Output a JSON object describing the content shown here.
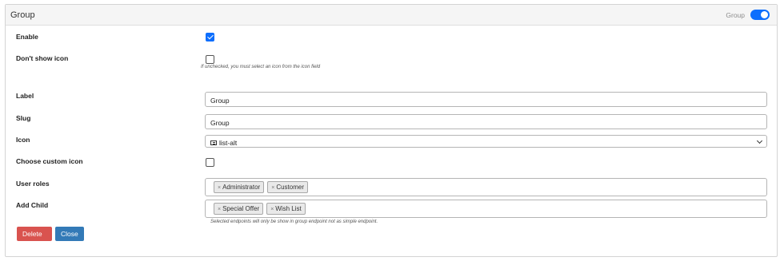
{
  "header": {
    "title": "Group",
    "toggle_label": "Group",
    "toggle_on": true
  },
  "fields": {
    "enable": {
      "label": "Enable",
      "checked": true
    },
    "dont_show_icon": {
      "label": "Don't show icon",
      "checked": false,
      "help": "If unchecked, you must select an icon from the icon field"
    },
    "label": {
      "label": "Label",
      "value": "Group"
    },
    "slug": {
      "label": "Slug",
      "value": "Group"
    },
    "icon": {
      "label": "Icon",
      "value": "list-alt",
      "icon": "list-alt-icon"
    },
    "choose_custom_icon": {
      "label": "Choose custom icon",
      "checked": false
    },
    "user_roles": {
      "label": "User roles",
      "tags": [
        "Administrator",
        "Customer"
      ]
    },
    "add_child": {
      "label": "Add Child",
      "tags": [
        "Special Offer",
        "Wish List"
      ],
      "help": "Selected endpoints will only be show in group endpoint not as simple endpoint."
    }
  },
  "buttons": {
    "delete": "Delete",
    "close": "Close"
  },
  "colors": {
    "primary": "#0d6efd",
    "delete": "#d9534f",
    "close": "#337ab7"
  },
  "tag_remove_glyph": "×"
}
